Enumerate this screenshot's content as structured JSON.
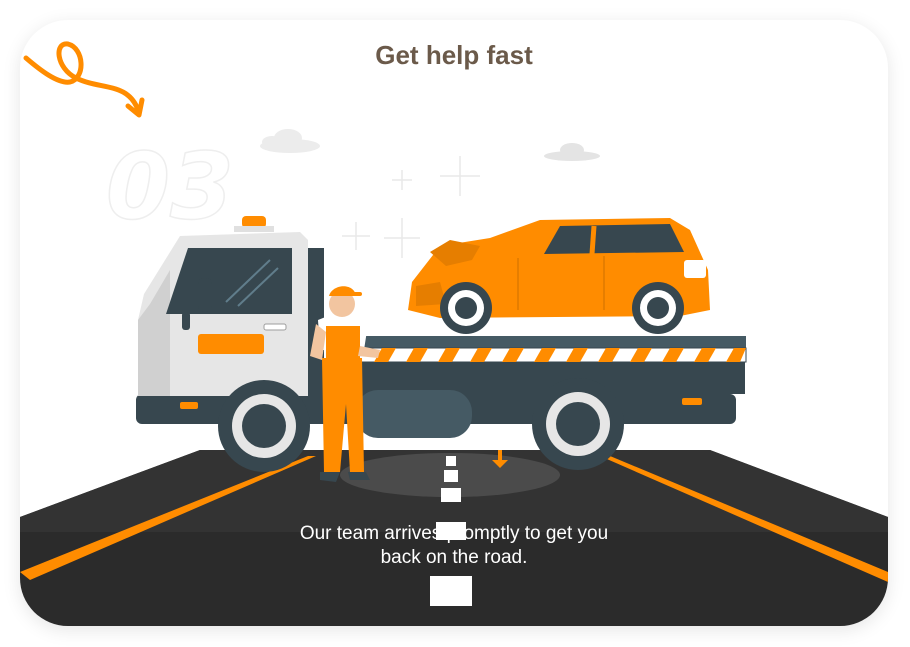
{
  "card": {
    "title": "Get help fast",
    "step_number": "03",
    "description_line1": "Our team arrives promptly to get you",
    "description_line2": "back on the road."
  },
  "colors": {
    "accent": "#ff8c00",
    "title": "#6b5a4a",
    "road": "#2d2d2d",
    "truck_body": "#e6e6e6",
    "truck_dark": "#37474f"
  },
  "icons": [
    "squiggle-arrow-icon",
    "tow-truck-illustration",
    "damaged-car-illustration",
    "mechanic-illustration"
  ]
}
